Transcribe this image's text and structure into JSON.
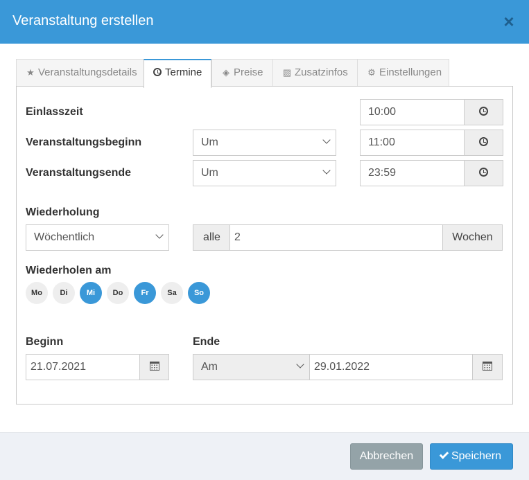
{
  "dialog": {
    "title": "Veranstaltung erstellen",
    "close_icon": "×"
  },
  "tabs": [
    {
      "label": "Veranstaltungsdetails",
      "icon": "star-icon"
    },
    {
      "label": "Termine",
      "icon": "clock-icon",
      "active": true
    },
    {
      "label": "Preise",
      "icon": "tag-icon"
    },
    {
      "label": "Zusatzinfos",
      "icon": "image-icon"
    },
    {
      "label": "Einstellungen",
      "icon": "gear-icon"
    }
  ],
  "schedule": {
    "admission": {
      "label": "Einlasszeit",
      "time": "10:00"
    },
    "start": {
      "label": "Veranstaltungsbeginn",
      "mode": "Um",
      "time": "11:00"
    },
    "end": {
      "label": "Veranstaltungsende",
      "mode": "Um",
      "time": "23:59"
    }
  },
  "repeat": {
    "label": "Wiederholung",
    "frequency": "Wöchentlich",
    "every_prefix": "alle",
    "every_value": "2",
    "every_unit": "Wochen",
    "days_label": "Wiederholen am",
    "days": [
      {
        "label": "Mo",
        "active": false
      },
      {
        "label": "Di",
        "active": false
      },
      {
        "label": "Mi",
        "active": true
      },
      {
        "label": "Do",
        "active": false
      },
      {
        "label": "Fr",
        "active": true
      },
      {
        "label": "Sa",
        "active": false
      },
      {
        "label": "So",
        "active": true
      }
    ]
  },
  "range": {
    "begin_label": "Beginn",
    "begin_date": "21.07.2021",
    "end_label": "Ende",
    "end_mode": "Am",
    "end_date": "29.01.2022"
  },
  "footer": {
    "cancel_label": "Abbrechen",
    "save_label": "Speichern"
  },
  "colors": {
    "accent": "#3a98d8",
    "cancel": "#94a3a8",
    "footer_bg": "#eef1f6"
  }
}
